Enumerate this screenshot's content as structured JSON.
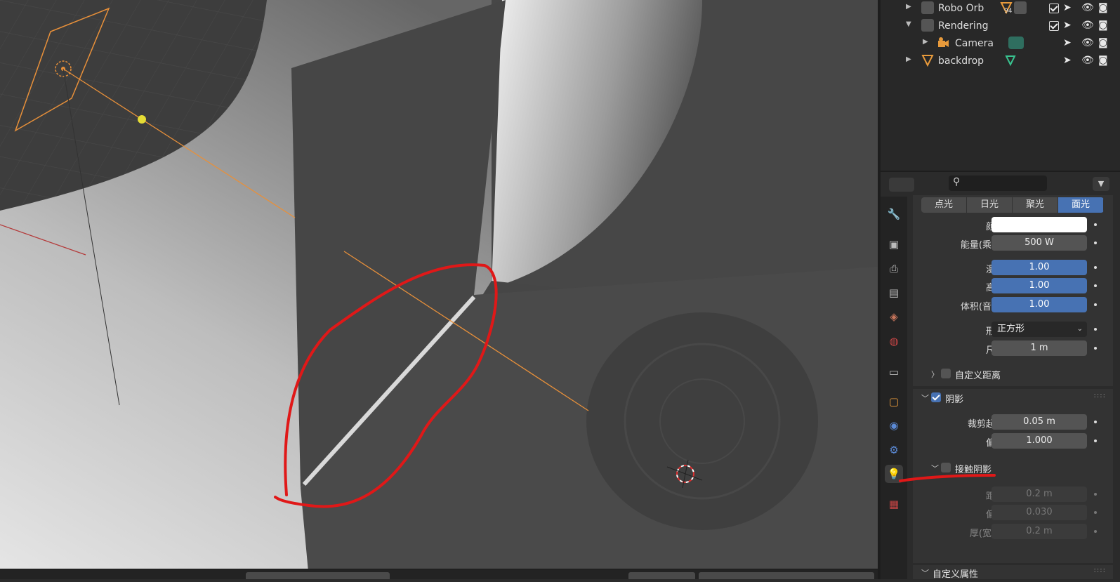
{
  "outliner": {
    "rows": [
      {
        "label": "Robo Orb",
        "badge": "94"
      },
      {
        "label": "Rendering"
      },
      {
        "label": "Camera"
      },
      {
        "label": "backdrop"
      }
    ]
  },
  "properties": {
    "search_placeholder": "",
    "light_types": [
      "点光",
      "日光",
      "聚光",
      "面光"
    ],
    "active_light_type": "面光",
    "fields": {
      "color_label": "颜色",
      "power_label": "能量(乘方)",
      "power_value": "500 W",
      "diffuse_label": "漫射",
      "diffuse_value": "1.00",
      "specular_label": "高光",
      "specular_value": "1.00",
      "volume_label": "体积(音量)",
      "volume_value": "1.00",
      "shape_label": "形状",
      "shape_value": "正方形",
      "size_label": "尺寸",
      "size_value": "1 m"
    },
    "custom_distance_label": "自定义距离",
    "shadow": {
      "title": "阴影",
      "clip_start_label": "裁剪起点",
      "clip_start_value": "0.05 m",
      "bias_label": "偏移",
      "bias_value": "1.000"
    },
    "contact_shadow": {
      "title": "接触阴影",
      "distance_label": "距离",
      "distance_value": "0.2 m",
      "bias_label": "偏移",
      "bias_value": "0.030",
      "thickness_label": "厚(宽)度",
      "thickness_value": "0.2 m"
    },
    "custom_props_title": "自定义属性"
  },
  "colors": {
    "accent": "#4772b3",
    "selection": "#ff9a2a",
    "annotation": "#e01818",
    "outliner_orange": "#e89a3b"
  }
}
